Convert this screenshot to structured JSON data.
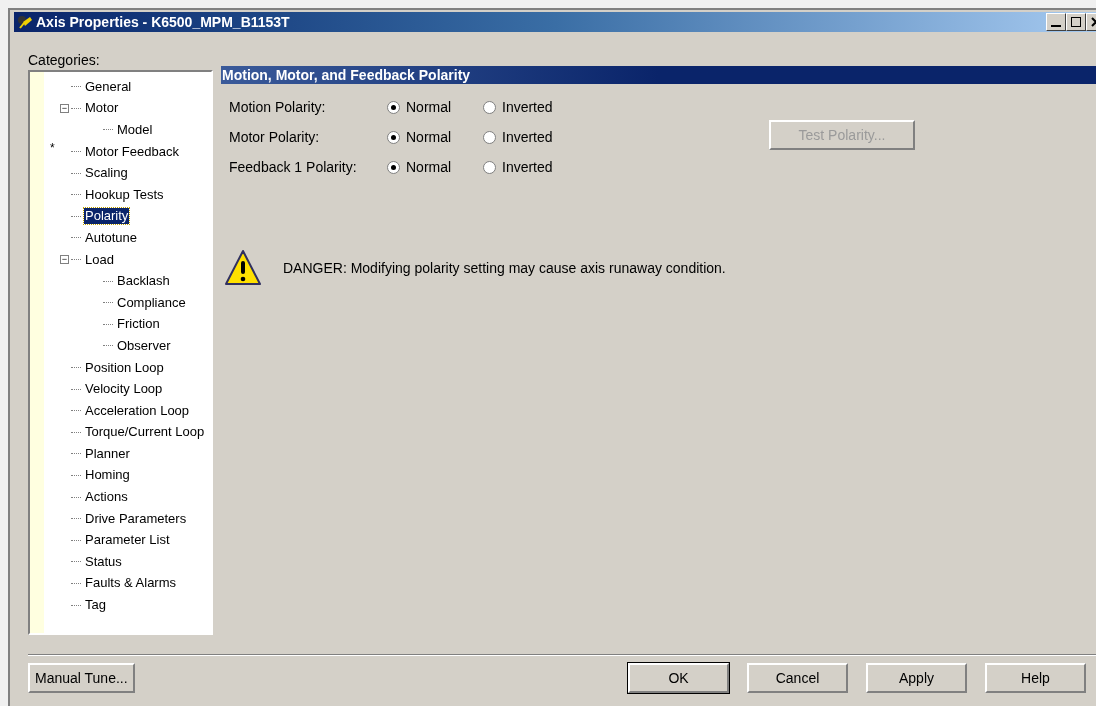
{
  "window": {
    "title": "Axis Properties - K6500_MPM_B1153T"
  },
  "categories_label": "Categories:",
  "tree": [
    {
      "label": "General",
      "selected": false
    },
    {
      "label": "Motor",
      "selected": false,
      "expanded": true,
      "expander": "−",
      "children": [
        {
          "label": "Model",
          "selected": false
        }
      ]
    },
    {
      "label": "Motor Feedback",
      "selected": false,
      "marker": "*"
    },
    {
      "label": "Scaling",
      "selected": false
    },
    {
      "label": "Hookup Tests",
      "selected": false
    },
    {
      "label": "Polarity",
      "selected": true
    },
    {
      "label": "Autotune",
      "selected": false
    },
    {
      "label": "Load",
      "selected": false,
      "expanded": true,
      "expander": "−",
      "children": [
        {
          "label": "Backlash",
          "selected": false
        },
        {
          "label": "Compliance",
          "selected": false
        },
        {
          "label": "Friction",
          "selected": false
        },
        {
          "label": "Observer",
          "selected": false
        }
      ]
    },
    {
      "label": "Position Loop",
      "selected": false
    },
    {
      "label": "Velocity Loop",
      "selected": false
    },
    {
      "label": "Acceleration Loop",
      "selected": false
    },
    {
      "label": "Torque/Current Loop",
      "selected": false
    },
    {
      "label": "Planner",
      "selected": false
    },
    {
      "label": "Homing",
      "selected": false
    },
    {
      "label": "Actions",
      "selected": false
    },
    {
      "label": "Drive Parameters",
      "selected": false
    },
    {
      "label": "Parameter List",
      "selected": false
    },
    {
      "label": "Status",
      "selected": false
    },
    {
      "label": "Faults & Alarms",
      "selected": false
    },
    {
      "label": "Tag",
      "selected": false
    }
  ],
  "panel": {
    "title": "Motion, Motor, and Feedback Polarity",
    "rows": [
      {
        "label": "Motion Polarity:",
        "options": [
          {
            "label": "Normal",
            "selected": true
          },
          {
            "label": "Inverted",
            "selected": false
          }
        ]
      },
      {
        "label": "Motor Polarity:",
        "options": [
          {
            "label": "Normal",
            "selected": true
          },
          {
            "label": "Inverted",
            "selected": false
          }
        ]
      },
      {
        "label": "Feedback 1 Polarity:",
        "options": [
          {
            "label": "Normal",
            "selected": true
          },
          {
            "label": "Inverted",
            "selected": false
          }
        ]
      }
    ],
    "test_button": {
      "label": "Test Polarity...",
      "disabled": true
    },
    "warning": "DANGER: Modifying polarity setting may cause axis runaway condition."
  },
  "buttons": [
    {
      "label": "Manual Tune...",
      "default": false
    },
    {
      "label": "OK",
      "default": true
    },
    {
      "label": "Cancel",
      "default": false
    },
    {
      "label": "Apply",
      "default": false
    },
    {
      "label": "Help",
      "default": false
    }
  ]
}
